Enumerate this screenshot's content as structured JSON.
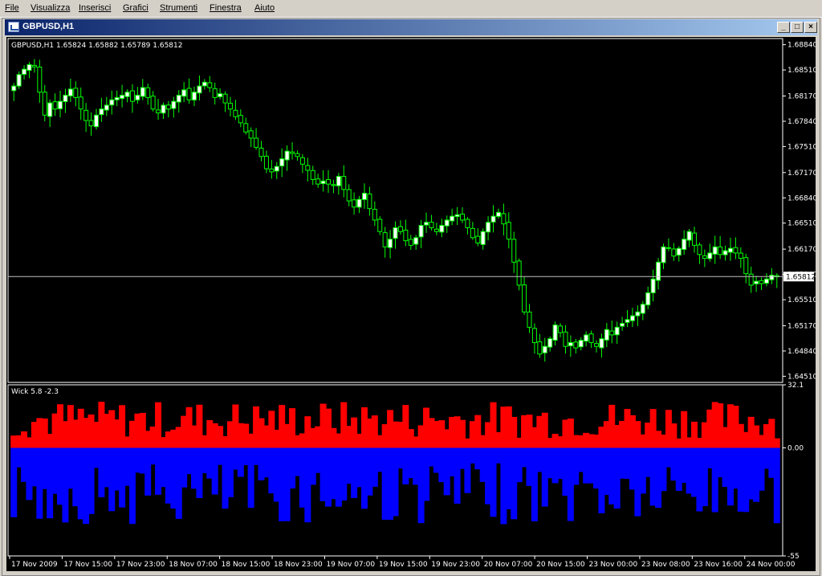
{
  "menu": {
    "items": [
      {
        "label": "File",
        "x": 6
      },
      {
        "label": "Visualizza",
        "x": 38
      },
      {
        "label": "Inserisci",
        "x": 98
      },
      {
        "label": "Grafici",
        "x": 153
      },
      {
        "label": "Strumenti",
        "x": 199
      },
      {
        "label": "Finestra",
        "x": 261
      },
      {
        "label": "Aiuto",
        "x": 317
      }
    ]
  },
  "window": {
    "title": "GBPUSD,H1",
    "minimize_glyph": "_",
    "restore_glyph": "□",
    "close_glyph": "×"
  },
  "chart": {
    "info": "GBPUSD,H1  1.65824 1.65882 1.65789 1.65812",
    "current_price_label": "1.65812",
    "price_scale": [
      "1.68840",
      "1.68510",
      "1.68170",
      "1.67840",
      "1.67510",
      "1.67170",
      "1.66840",
      "1.66510",
      "1.66170",
      "1.65840",
      "1.65510",
      "1.65170",
      "1.64840",
      "1.64510"
    ],
    "indicator_title": "Wick  5.8 -2.3",
    "indicator_scale": [
      "32.1",
      "0.00",
      "-55"
    ],
    "time_labels": [
      "17 Nov 2009",
      "17 Nov 15:00",
      "17 Nov 23:00",
      "18 Nov 07:00",
      "18 Nov 15:00",
      "18 Nov 23:00",
      "19 Nov 07:00",
      "19 Nov 15:00",
      "19 Nov 23:00",
      "20 Nov 07:00",
      "20 Nov 15:00",
      "23 Nov 00:00",
      "23 Nov 08:00",
      "23 Nov 16:00",
      "24 Nov 00:00"
    ],
    "colors": {
      "bull_fill": "#ffffff",
      "bull_outline": "#00ff00",
      "bear_fill": "#000000",
      "wick": "#00ff00",
      "upper_wick_hist": "#ff0000",
      "lower_wick_hist": "#0000ff",
      "axis": "#ffffff",
      "price_line": "#c0c0c0"
    }
  },
  "chart_data": {
    "type": "candlestick",
    "series": [
      {
        "name": "GBPUSD,H1"
      },
      {
        "name": "Wick"
      }
    ],
    "close_path": [
      1.683,
      1.6845,
      1.6852,
      1.6858,
      1.6855,
      1.6822,
      1.6792,
      1.6808,
      1.68,
      1.681,
      1.6818,
      1.6826,
      1.6815,
      1.68,
      1.6785,
      1.6778,
      1.6792,
      1.68,
      1.6805,
      1.6812,
      1.6815,
      1.6818,
      1.6822,
      1.681,
      1.6818,
      1.6828,
      1.6815,
      1.68,
      1.6795,
      1.6805,
      1.68,
      1.681,
      1.6818,
      1.6825,
      1.6812,
      1.6822,
      1.683,
      1.6835,
      1.6828,
      1.6815,
      1.682,
      1.6808,
      1.68,
      1.679,
      1.6782,
      1.677,
      1.6762,
      1.675,
      1.6738,
      1.6722,
      1.6718,
      1.6725,
      1.6735,
      1.6745,
      1.6742,
      1.6738,
      1.6728,
      1.672,
      1.6708,
      1.6702,
      1.6706,
      1.6702,
      1.67,
      1.6712,
      1.6695,
      1.668,
      1.6672,
      1.6682,
      1.669,
      1.667,
      1.6655,
      1.664,
      1.662,
      1.663,
      1.6645,
      1.664,
      1.6628,
      1.6622,
      1.6632,
      1.6648,
      1.6652,
      1.6645,
      1.664,
      1.6648,
      1.6655,
      1.666,
      1.6662,
      1.6655,
      1.6645,
      1.6632,
      1.6625,
      1.664,
      1.6652,
      1.666,
      1.6665,
      1.665,
      1.663,
      1.66,
      1.657,
      1.6535,
      1.6515,
      1.6495,
      1.648,
      1.649,
      1.65,
      1.6518,
      1.6508,
      1.649,
      1.6495,
      1.6488,
      1.6498,
      1.6505,
      1.6495,
      1.649,
      1.65,
      1.6512,
      1.6505,
      1.6515,
      1.652,
      1.6525,
      1.653,
      1.6535,
      1.6545,
      1.656,
      1.6578,
      1.66,
      1.662,
      1.6618,
      1.6608,
      1.6618,
      1.663,
      1.664,
      1.6622,
      1.661,
      1.6605,
      1.6612,
      1.662,
      1.661,
      1.6615,
      1.6618,
      1.6612,
      1.6605,
      1.6585,
      1.657,
      1.6575,
      1.6572,
      1.6578,
      1.6583,
      1.6581
    ],
    "ylim": [
      1.6443,
      1.6892
    ],
    "wick_ylim": [
      -55,
      32.1
    ],
    "current_price": 1.65812,
    "last_wick": {
      "upper": 5.8,
      "lower": -2.3
    }
  }
}
